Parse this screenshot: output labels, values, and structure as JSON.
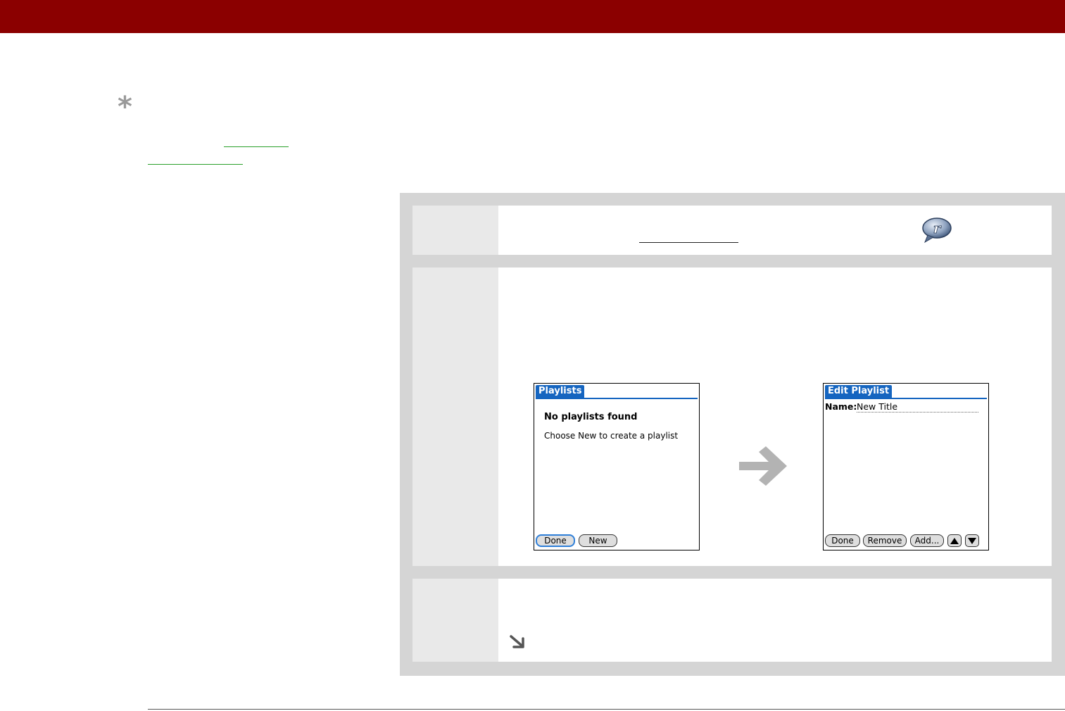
{
  "icons": {
    "tip": "asterisk-icon",
    "app": "realplayer-icon",
    "transition": "arrow-right-icon",
    "continued": "arrow-down-right-icon"
  },
  "colors": {
    "header": "#8b0000",
    "link": "#2aa02a",
    "panel": "#d5d5d5",
    "step_number_bg": "#e9e9e9",
    "title_bar": "#1565c0",
    "selected_button_outline": "#2f7fd8"
  },
  "screens": {
    "playlists": {
      "title": "Playlists",
      "message_heading": "No playlists found",
      "message_body": "Choose New to create a playlist",
      "buttons": {
        "done": "Done",
        "new": "New"
      }
    },
    "edit_playlist": {
      "title": "Edit Playlist",
      "name_label": "Name:",
      "name_value": "New Title",
      "buttons": {
        "done": "Done",
        "remove": "Remove",
        "add": "Add..."
      }
    }
  }
}
